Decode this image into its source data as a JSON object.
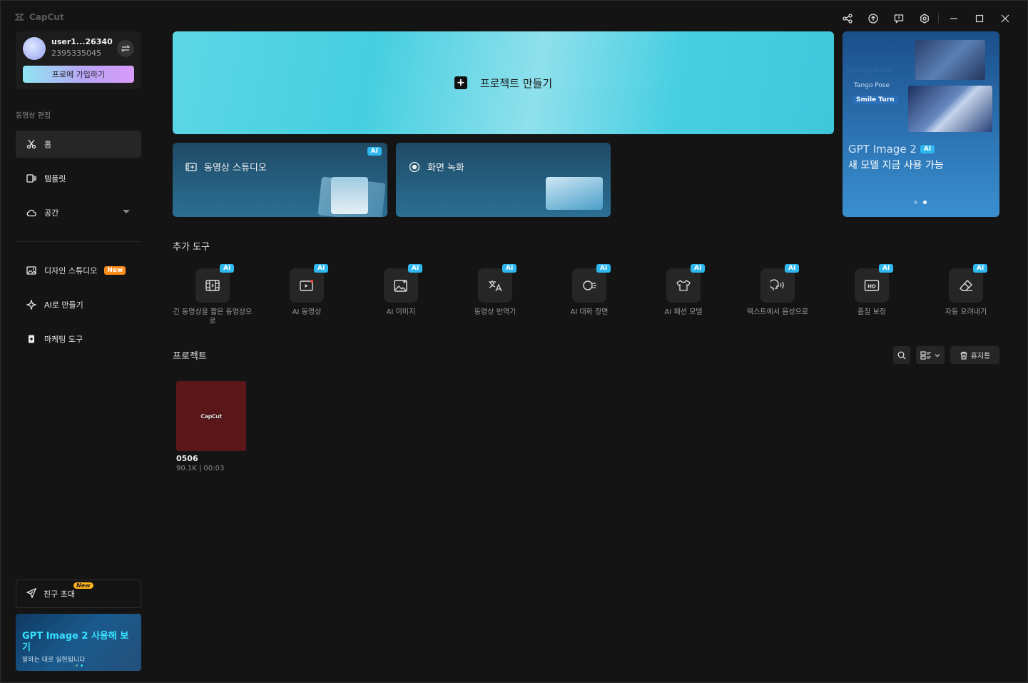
{
  "app": {
    "logo_text": "CapCut"
  },
  "account": {
    "username": "user1...26340",
    "user_id": "2395335045",
    "pro_button": "프로에 가입하기"
  },
  "sidebar": {
    "section_label": "동영상 편집",
    "items": [
      {
        "label": "홈"
      },
      {
        "label": "템플릿"
      },
      {
        "label": "공간"
      }
    ],
    "items2": [
      {
        "label": "디자인 스튜디오",
        "badge": "New"
      },
      {
        "label": "AI로 만들기"
      },
      {
        "label": "마케팅 도구"
      }
    ],
    "invite": {
      "label": "친구 초대",
      "badge": "New"
    },
    "promo": {
      "title": "GPT Image 2 사용해 보기",
      "subtitle": "말하는 대로 실현됩니다"
    }
  },
  "main": {
    "create_label": "프로젝트 만들기",
    "cards": [
      {
        "label": "동영상 스튜디오",
        "badge": "AI"
      },
      {
        "label": "화면 녹화"
      }
    ],
    "hero": {
      "small1": "Spotlight Dance",
      "small2": "Tango Pose",
      "small3": "Smile Turn",
      "title": "GPT Image 2",
      "badge": "AI",
      "subtitle": "새 모델 지금 사용 가능"
    },
    "tools_title": "추가 도구",
    "tools": [
      {
        "label": "긴 동영상을 짧은 동영상으로",
        "badge": "AI",
        "icon": "film-cut-icon"
      },
      {
        "label": "AI 동영상",
        "badge": "AI",
        "icon": "ai-video-icon"
      },
      {
        "label": "AI 이미지",
        "badge": "AI",
        "icon": "ai-image-icon"
      },
      {
        "label": "동영상 번역기",
        "badge": "AI",
        "icon": "translate-icon"
      },
      {
        "label": "AI 대화 장면",
        "badge": "AI",
        "icon": "dialogue-icon"
      },
      {
        "label": "AI 패션 모델",
        "badge": "AI",
        "icon": "shirt-icon"
      },
      {
        "label": "텍스트에서 음성으로",
        "badge": "AI",
        "icon": "voice-icon"
      },
      {
        "label": "품질 보정",
        "badge": "AI",
        "icon": "hd-icon"
      },
      {
        "label": "자동 오려내기",
        "badge": "AI",
        "icon": "eraser-icon"
      }
    ],
    "projects_title": "프로젝트",
    "trash_label": "휴지통",
    "projects": [
      {
        "name": "0506",
        "meta": "90.1K | 00:03",
        "thumb_text": "CapCut"
      }
    ]
  }
}
